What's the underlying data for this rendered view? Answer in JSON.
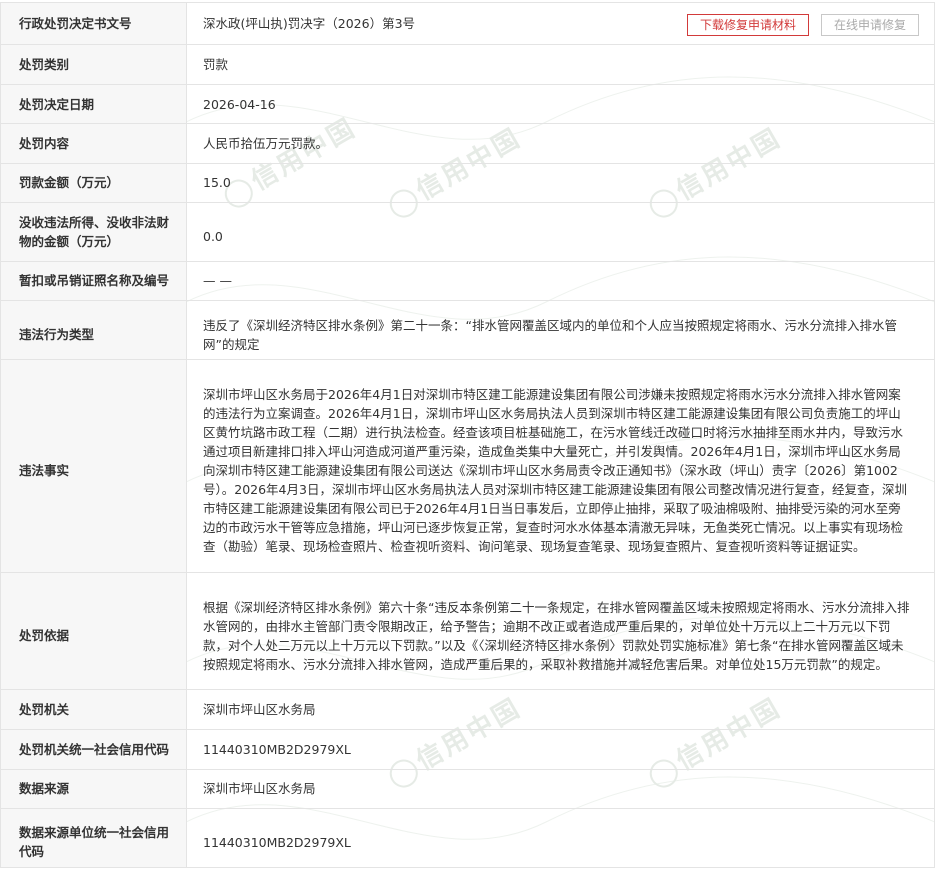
{
  "header": {
    "label": "行政处罚决定书文号",
    "value": "深水政(坪山执)罚决字（2026）第3号",
    "download_button": "下载修复申请材料",
    "online_button": "在线申请修复"
  },
  "watermark": {
    "text": "信用中国"
  },
  "rows": [
    {
      "label": "处罚类别",
      "value": "罚款"
    },
    {
      "label": "处罚决定日期",
      "value": "2026-04-16"
    },
    {
      "label": "处罚内容",
      "value": "人民币拾伍万元罚款。"
    },
    {
      "label": "罚款金额（万元）",
      "value": "15.0"
    },
    {
      "label": "没收违法所得、没收非法财物的金额（万元）",
      "value": "0.0"
    },
    {
      "label": "暂扣或吊销证照名称及编号",
      "value": "— —"
    },
    {
      "label": "违法行为类型",
      "value": "违反了《深圳经济特区排水条例》第二十一条：“排水管网覆盖区域内的单位和个人应当按照规定将雨水、污水分流排入排水管网”的规定"
    },
    {
      "label": "违法事实",
      "value": "深圳市坪山区水务局于2026年4月1日对深圳市特区建工能源建设集团有限公司涉嫌未按照规定将雨水污水分流排入排水管网案的违法行为立案调查。2026年4月1日，深圳市坪山区水务局执法人员到深圳市特区建工能源建设集团有限公司负责施工的坪山区黄竹坑路市政工程（二期）进行执法检查。经查该项目桩基础施工，在污水管线迁改碰口时将污水抽排至雨水井内，导致污水通过项目新建排口排入坪山河造成河道严重污染，造成鱼类集中大量死亡，并引发舆情。2026年4月1日，深圳市坪山区水务局向深圳市特区建工能源建设集团有限公司送达《深圳市坪山区水务局责令改正通知书》（深水政（坪山）责字〔2026〕第1002号）。2026年4月3日，深圳市坪山区水务局执法人员对深圳市特区建工能源建设集团有限公司整改情况进行复查，经复查，深圳市特区建工能源建设集团有限公司已于2026年4月1日当日事发后，立即停止抽排，采取了吸油棉吸附、抽排受污染的河水至旁边的市政污水干管等应急措施，坪山河已逐步恢复正常，复查时河水水体基本清澈无异味，无鱼类死亡情况。以上事实有现场检查（勘验）笔录、现场检查照片、检查视听资料、询问笔录、现场复查笔录、现场复查照片、复查视听资料等证据证实。"
    },
    {
      "label": "处罚依据",
      "value": "根据《深圳经济特区排水条例》第六十条“违反本条例第二十一条规定，在排水管网覆盖区域未按照规定将雨水、污水分流排入排水管网的，由排水主管部门责令限期改正，给予警告；逾期不改正或者造成严重后果的，对单位处十万元以上二十万元以下罚款，对个人处二万元以上十万元以下罚款。”以及《〈深圳经济特区排水条例〉罚款处罚实施标准》第七条“在排水管网覆盖区域未按照规定将雨水、污水分流排入排水管网，造成严重后果的，采取补救措施并减轻危害后果。对单位处15万元罚款”的规定。"
    },
    {
      "label": "处罚机关",
      "value": "深圳市坪山区水务局"
    },
    {
      "label": "处罚机关统一社会信用代码",
      "value": "11440310MB2D2979XL"
    },
    {
      "label": "数据来源",
      "value": "深圳市坪山区水务局"
    },
    {
      "label": "数据来源单位统一社会信用代码",
      "value": "11440310MB2D2979XL"
    }
  ]
}
